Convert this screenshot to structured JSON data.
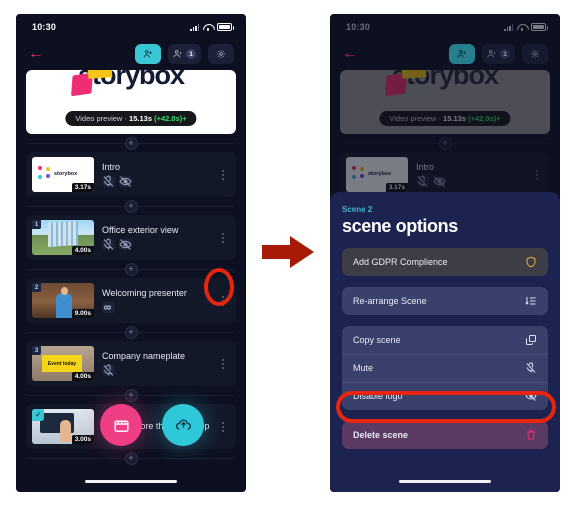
{
  "meta": {
    "accent_pink": "#ef2d72",
    "accent_cyan": "#39c7d6",
    "annotation_red": "#e8250c",
    "arrow_red": "#a81a07",
    "sheet_blue": "#1d2351"
  },
  "status_bar": {
    "time": "10:30",
    "signal_icon": "cellular-signal-icon",
    "wifi_icon": "wifi-icon",
    "battery_icon": "battery-icon"
  },
  "app_bar": {
    "back_icon": "back-arrow-icon",
    "add_person_icon": "add-person-icon",
    "people_icon": "people-icon",
    "people_count": "1",
    "settings_icon": "gear-icon"
  },
  "preview": {
    "brand": "storybox",
    "label": "Video preview",
    "separator": "·",
    "duration": "15.13s",
    "extra": "(+42.0s)+"
  },
  "scenes": [
    {
      "index": "",
      "title": "Intro",
      "duration": "3.17s",
      "art": "art-intro",
      "badges": [
        "mic-off-icon",
        "eye-off-icon"
      ],
      "kebab": "scene-menu-icon",
      "thumb_brand": "storybox"
    },
    {
      "index": "1",
      "title": "Office exterior view",
      "duration": "4.00s",
      "art": "art-office",
      "badges": [
        "mic-off-icon",
        "eye-off-icon"
      ],
      "kebab": "scene-menu-icon"
    },
    {
      "index": "2",
      "title": "Welcoming presenter",
      "duration": "9.00s",
      "art": "art-presenter",
      "badges": [
        "infinity-icon"
      ],
      "kebab": "scene-menu-icon",
      "annotated": true
    },
    {
      "index": "3",
      "title": "Company nameplate",
      "duration": "4.00s",
      "art": "art-nameplate",
      "plate_text": "Event today",
      "badges": [
        "mic-off-icon"
      ],
      "kebab": "scene-menu-icon"
    },
    {
      "index": "✓",
      "title": "Office before the workshop",
      "duration": "3.00s",
      "art": "art-workshop",
      "badges": [],
      "kebab": "scene-menu-icon",
      "selected": true
    }
  ],
  "add_scene_label": "+",
  "fabs": {
    "record_icon": "clapperboard-icon",
    "upload_icon": "upload-cloud-icon"
  },
  "sheet": {
    "eyebrow": "Scene 2",
    "title": "scene options",
    "groups": [
      {
        "style": "g-gdpr",
        "options": [
          {
            "label": "Add GDPR Complience",
            "icon": "shield-icon",
            "icon_color": "#e2b33c"
          }
        ]
      },
      {
        "style": "g-rearrange",
        "options": [
          {
            "label": "Re-arrange Scene",
            "icon": "sort-list-icon",
            "icon_color": "#dfe3f2"
          }
        ]
      },
      {
        "style": "g-mid",
        "options": [
          {
            "label": "Copy scene",
            "icon": "copy-icon",
            "icon_color": "#dfe3f2"
          },
          {
            "label": "Mute",
            "icon": "mic-off-icon",
            "icon_color": "#dfe3f2"
          },
          {
            "label": "Disable logo",
            "icon": "eye-off-icon",
            "icon_color": "#dfe3f2",
            "annotated": true
          }
        ]
      },
      {
        "style": "g-delete",
        "options": [
          {
            "label": "Delete scene",
            "icon": "trash-icon",
            "icon_color": "#ef2d72"
          }
        ]
      }
    ]
  },
  "arrow": {
    "name": "flow-arrow-right",
    "color": "#a81a07"
  }
}
